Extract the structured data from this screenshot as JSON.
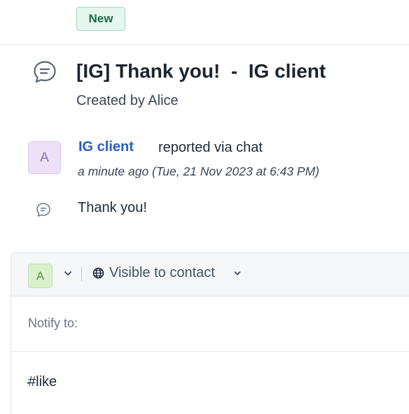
{
  "ticket": {
    "status": "New",
    "title": "[IG] Thank you!  -  IG client",
    "created_by": "Created by Alice"
  },
  "activity": {
    "avatar_initial": "A",
    "requester": "IG client",
    "channel_text": "reported via chat",
    "timestamp": "a minute ago (Tue, 21 Nov 2023 at 6:43 PM)",
    "message": "Thank you!"
  },
  "reply": {
    "agent_initial": "A",
    "visibility_label": "Visible to contact",
    "notify_label": "Notify to:",
    "editor_text": "#like"
  },
  "icons": {
    "ticket": "chat-bubble-icon",
    "message": "chat-bubble-icon",
    "agent_dropdown": "chevron-down-icon",
    "visibility": "globe-icon",
    "visibility_dropdown": "chevron-down-icon"
  },
  "colors": {
    "status_badge_bg": "#e5f6ee",
    "status_badge_text": "#1b6c47",
    "link": "#2c5cc5",
    "requester_avatar_bg": "#ece1f7",
    "agent_avatar_bg": "#d9f0cd"
  }
}
